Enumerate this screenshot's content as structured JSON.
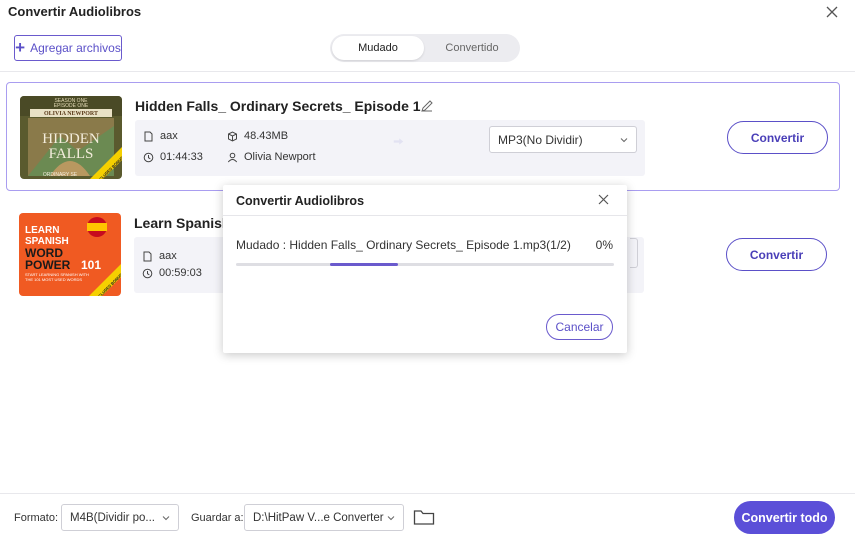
{
  "window": {
    "title": "Convertir Audiolibros"
  },
  "toolbar": {
    "add_label": "Agregar archivos"
  },
  "tabs": [
    {
      "label": "Mudado"
    },
    {
      "label": "Convertido"
    }
  ],
  "books": [
    {
      "title": "Hidden Falls_ Ordinary Secrets_ Episode 1",
      "format": "aax",
      "duration": "01:44:33",
      "size": "48.43MB",
      "author": "Olivia Newport",
      "output": "MP3(No Dividir)",
      "convert_label": "Convertir",
      "cover": {
        "top": "SEASON ONE",
        "line2": "EPISODE ONE",
        "author": "OLIVIA NEWPORT",
        "word1": "HIDDEN",
        "word2": "FALLS",
        "sub": "ORDINARY SE",
        "badge": "INCLUDES BONUS"
      }
    },
    {
      "title": "Learn Spanish",
      "format": "aax",
      "duration": "00:59:03",
      "convert_label": "Convertir",
      "cover": {
        "l1": "LEARN",
        "l2": "SPANISH",
        "l3": "WORD",
        "l4": "POWER",
        "num": "101",
        "small1": "START LEARNING SPANISH WITH",
        "small2": "THE 101 MOST USED WORDS",
        "badge": "INCLUDES BONUS"
      }
    }
  ],
  "dialog": {
    "title": "Convertir Audiolibros",
    "file": "Mudado : Hidden Falls_ Ordinary Secrets_ Episode 1.mp3(1/2)",
    "percent": "0%",
    "cancel_label": "Cancelar"
  },
  "footer": {
    "format_label": "Formato:",
    "format_value": "M4B(Dividir po...",
    "save_label": "Guardar a:",
    "save_value": "D:\\HitPaw V...e Converter",
    "convert_all_label": "Convertir todo"
  },
  "colors": {
    "accent": "#5b4fd8",
    "accent_border": "#6a5acd",
    "selected_card_border": "#a99df0",
    "spanish_cover": "#f05a22",
    "hidden_falls_cover": "#6e6a3a"
  },
  "icons": {
    "file": "file-icon",
    "clock": "clock-icon",
    "box": "box-icon",
    "user": "user-icon",
    "edit": "pencil-icon",
    "arrow": "arrow-right-icon",
    "folder": "folder-icon",
    "close": "close-icon",
    "plus": "plus-icon"
  }
}
